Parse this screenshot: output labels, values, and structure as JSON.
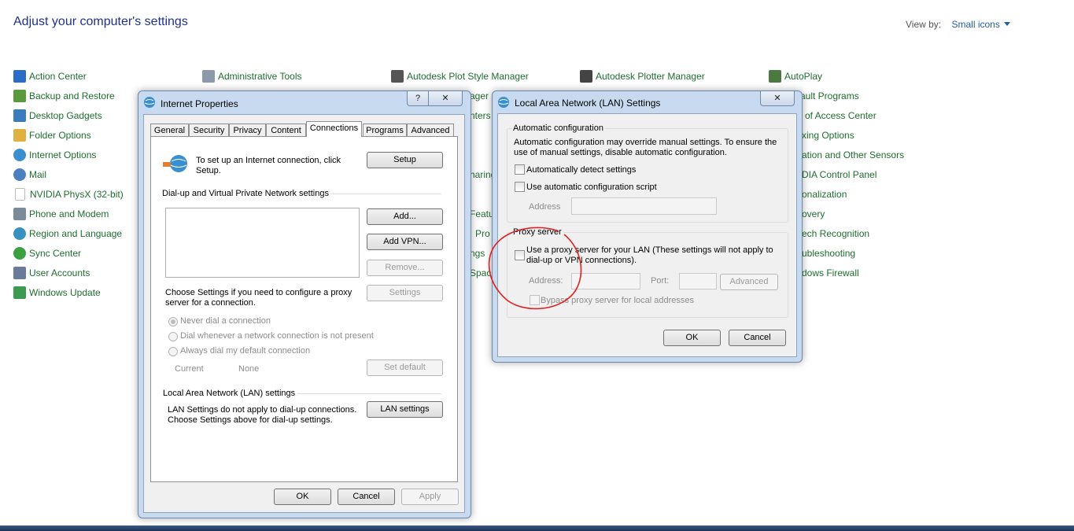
{
  "control_panel": {
    "title": "Adjust your computer's settings",
    "view_by_label": "View by:",
    "view_by_value": "Small icons",
    "items": [
      {
        "label": "Action Center",
        "icon": "flag-icon",
        "color": "#2a6cc8"
      },
      {
        "label": "Backup and Restore",
        "icon": "backup-icon",
        "color": "#5a9a3a"
      },
      {
        "label": "Desktop Gadgets",
        "icon": "gadgets-icon",
        "color": "#3a7cc0"
      },
      {
        "label": "Folder Options",
        "icon": "folder-icon",
        "color": "#e0b040"
      },
      {
        "label": "Internet Options",
        "icon": "globe-icon",
        "color": "#3a8fd0"
      },
      {
        "label": "Mail",
        "icon": "mail-icon",
        "color": "#4a80c0"
      },
      {
        "label": "NVIDIA PhysX (32-bit)",
        "icon": "document-icon",
        "color": "#dddddd"
      },
      {
        "label": "Phone and Modem",
        "icon": "phone-icon",
        "color": "#7a8a9a"
      },
      {
        "label": "Region and Language",
        "icon": "region-icon",
        "color": "#3a90c0"
      },
      {
        "label": "Sync Center",
        "icon": "sync-icon",
        "color": "#3aa040"
      },
      {
        "label": "User Accounts",
        "icon": "users-icon",
        "color": "#6a7a9a"
      },
      {
        "label": "Windows Update",
        "icon": "update-icon",
        "color": "#3a9a50"
      },
      {
        "label": "Administrative Tools",
        "icon": "admin-tools-icon",
        "color": "#8a9aaa"
      },
      {
        "label": "Autodesk Plot Style Manager",
        "icon": "printer-icon",
        "color": "#555555"
      },
      {
        "label": "Autodesk Plotter Manager",
        "icon": "plotter-icon",
        "color": "#444444"
      },
      {
        "label": "AutoPlay",
        "icon": "autoplay-icon",
        "color": "#4a7a40"
      },
      {
        "label": "ager",
        "icon": "printer-icon",
        "color": "#c0a060"
      },
      {
        "label": "nters",
        "icon": "none",
        "color": "#ffffff"
      },
      {
        "label": "haring",
        "icon": "none",
        "color": "#ffffff"
      },
      {
        "label": "Featu",
        "icon": "none",
        "color": "#ffffff"
      },
      {
        "label": "Pro",
        "icon": "none",
        "color": "#ffffff"
      },
      {
        "label": "ngs",
        "icon": "none",
        "color": "#ffffff"
      },
      {
        "label": "Space",
        "icon": "none",
        "color": "#ffffff"
      },
      {
        "label": "ault Programs",
        "icon": "none",
        "color": "#ffffff"
      },
      {
        "label": "of Access Center",
        "icon": "none",
        "color": "#ffffff"
      },
      {
        "label": "xing Options",
        "icon": "none",
        "color": "#ffffff"
      },
      {
        "label": "ation and Other Sensors",
        "icon": "none",
        "color": "#ffffff"
      },
      {
        "label": "DIA Control Panel",
        "icon": "none",
        "color": "#ffffff"
      },
      {
        "label": "onalization",
        "icon": "none",
        "color": "#ffffff"
      },
      {
        "label": "overy",
        "icon": "none",
        "color": "#ffffff"
      },
      {
        "label": "ech Recognition",
        "icon": "none",
        "color": "#ffffff"
      },
      {
        "label": "ubleshooting",
        "icon": "none",
        "color": "#ffffff"
      },
      {
        "label": "dows Firewall",
        "icon": "none",
        "color": "#ffffff"
      }
    ]
  },
  "internet_properties": {
    "title": "Internet Properties",
    "help": "?",
    "close": "✕",
    "tabs": [
      "General",
      "Security",
      "Privacy",
      "Content",
      "Connections",
      "Programs",
      "Advanced"
    ],
    "setup_text": "To set up an Internet connection, click Setup.",
    "setup_button": "Setup",
    "dialup_heading": "Dial-up and Virtual Private Network settings",
    "add_button": "Add...",
    "add_vpn_button": "Add VPN...",
    "remove_button": "Remove...",
    "settings_text": "Choose Settings if you need to configure a proxy server for a connection.",
    "settings_button": "Settings",
    "radio_never": "Never dial a connection",
    "radio_whenever": "Dial whenever a network connection is not present",
    "radio_always": "Always dial my default connection",
    "current_label": "Current",
    "current_value": "None",
    "set_default_button": "Set default",
    "lan_heading": "Local Area Network (LAN) settings",
    "lan_text": "LAN Settings do not apply to dial-up connections. Choose Settings above for dial-up settings.",
    "lan_button": "LAN settings",
    "ok": "OK",
    "cancel": "Cancel",
    "apply": "Apply"
  },
  "lan_settings": {
    "title": "Local Area Network (LAN) Settings",
    "close": "✕",
    "auto_heading": "Automatic configuration",
    "auto_text": "Automatic configuration may override manual settings.  To ensure the use of manual settings, disable automatic configuration.",
    "auto_detect": "Automatically detect settings",
    "auto_script": "Use automatic configuration script",
    "address_label": "Address",
    "proxy_heading": "Proxy server",
    "proxy_text": "Use a proxy server for your LAN (These settings will not apply to dial-up or VPN connections).",
    "proxy_address_label": "Address:",
    "port_label": "Port:",
    "advanced_button": "Advanced",
    "bypass": "Bypass proxy server for local addresses",
    "ok": "OK",
    "cancel": "Cancel"
  },
  "annotation": {
    "color": "#e02020"
  }
}
